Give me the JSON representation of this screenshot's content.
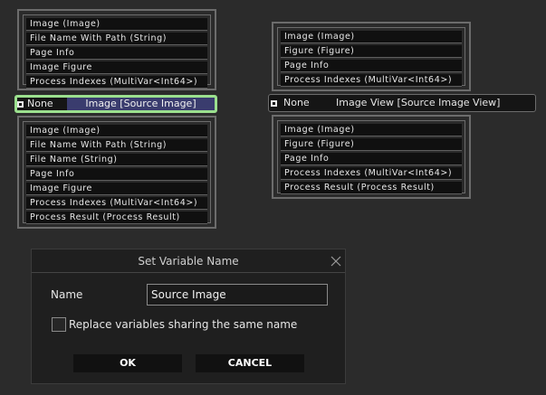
{
  "nodes": {
    "left_top_rows": [
      "Image (Image)",
      "File Name With Path (String)",
      "Page Info",
      "Image Figure",
      "Process Indexes (MultiVar<Int64>)"
    ],
    "left_connector": {
      "left": "None",
      "right": "Image [Source Image]"
    },
    "left_bottom_rows": [
      "Image (Image)",
      "File Name With Path (String)",
      "File Name (String)",
      "Page Info",
      "Image Figure",
      "Process Indexes (MultiVar<Int64>)",
      "Process Result (Process Result)"
    ],
    "right_top_rows": [
      "Image (Image)",
      "Figure (Figure)",
      "Page Info",
      "Process Indexes (MultiVar<Int64>)"
    ],
    "right_connector": {
      "left": "None",
      "right": "Image View [Source Image View]"
    },
    "right_bottom_rows": [
      "Image (Image)",
      "Figure (Figure)",
      "Page Info",
      "Process Indexes (MultiVar<Int64>)",
      "Process Result (Process Result)"
    ]
  },
  "dialog": {
    "title": "Set Variable Name",
    "name_label": "Name",
    "name_value": "Source Image",
    "checkbox_label": "Replace variables sharing the same name",
    "checkbox_checked": false,
    "ok_label": "OK",
    "cancel_label": "CANCEL",
    "close_icon": "close-icon"
  },
  "colors": {
    "background": "#2b2b2b",
    "panel_border": "#6c6c6c",
    "row_background": "#101010",
    "selected_connector_border": "#9be08e",
    "source_highlight": "#3a3c6e",
    "dialog_background": "#1f1f1f"
  }
}
